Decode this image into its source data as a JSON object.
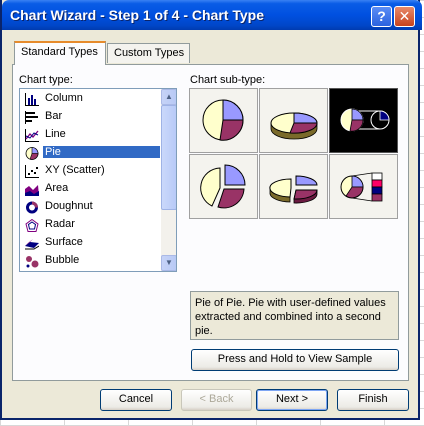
{
  "window": {
    "title": "Chart Wizard - Step 1 of 4 - Chart Type",
    "help_label": "?",
    "close_label": "✕"
  },
  "tabs": [
    {
      "label": "Standard Types",
      "active": true
    },
    {
      "label": "Custom Types",
      "active": false
    }
  ],
  "chart_type": {
    "label": "Chart type:",
    "items": [
      {
        "label": "Column",
        "icon": "column-chart-icon"
      },
      {
        "label": "Bar",
        "icon": "bar-chart-icon"
      },
      {
        "label": "Line",
        "icon": "line-chart-icon"
      },
      {
        "label": "Pie",
        "icon": "pie-chart-icon",
        "selected": true
      },
      {
        "label": "XY (Scatter)",
        "icon": "scatter-chart-icon"
      },
      {
        "label": "Area",
        "icon": "area-chart-icon"
      },
      {
        "label": "Doughnut",
        "icon": "doughnut-chart-icon"
      },
      {
        "label": "Radar",
        "icon": "radar-chart-icon"
      },
      {
        "label": "Surface",
        "icon": "surface-chart-icon"
      },
      {
        "label": "Bubble",
        "icon": "bubble-chart-icon"
      }
    ]
  },
  "sub_type": {
    "label": "Chart sub-type:",
    "items": [
      {
        "icon": "pie-icon"
      },
      {
        "icon": "3d-pie-icon"
      },
      {
        "icon": "pie-of-pie-icon",
        "selected": true
      },
      {
        "icon": "exploded-pie-icon"
      },
      {
        "icon": "exploded-3d-pie-icon"
      },
      {
        "icon": "bar-of-pie-icon"
      }
    ],
    "description": "Pie of Pie. Pie with user-defined values extracted and combined into a second pie."
  },
  "sample_button": "Press and Hold to View Sample",
  "buttons": {
    "cancel": "Cancel",
    "back": "< Back",
    "next": "Next >",
    "finish": "Finish"
  },
  "colors": {
    "pie_light": "#ffffcc",
    "pie_blue": "#9999ff",
    "pie_maroon": "#993366",
    "selection": "#316ac5"
  }
}
